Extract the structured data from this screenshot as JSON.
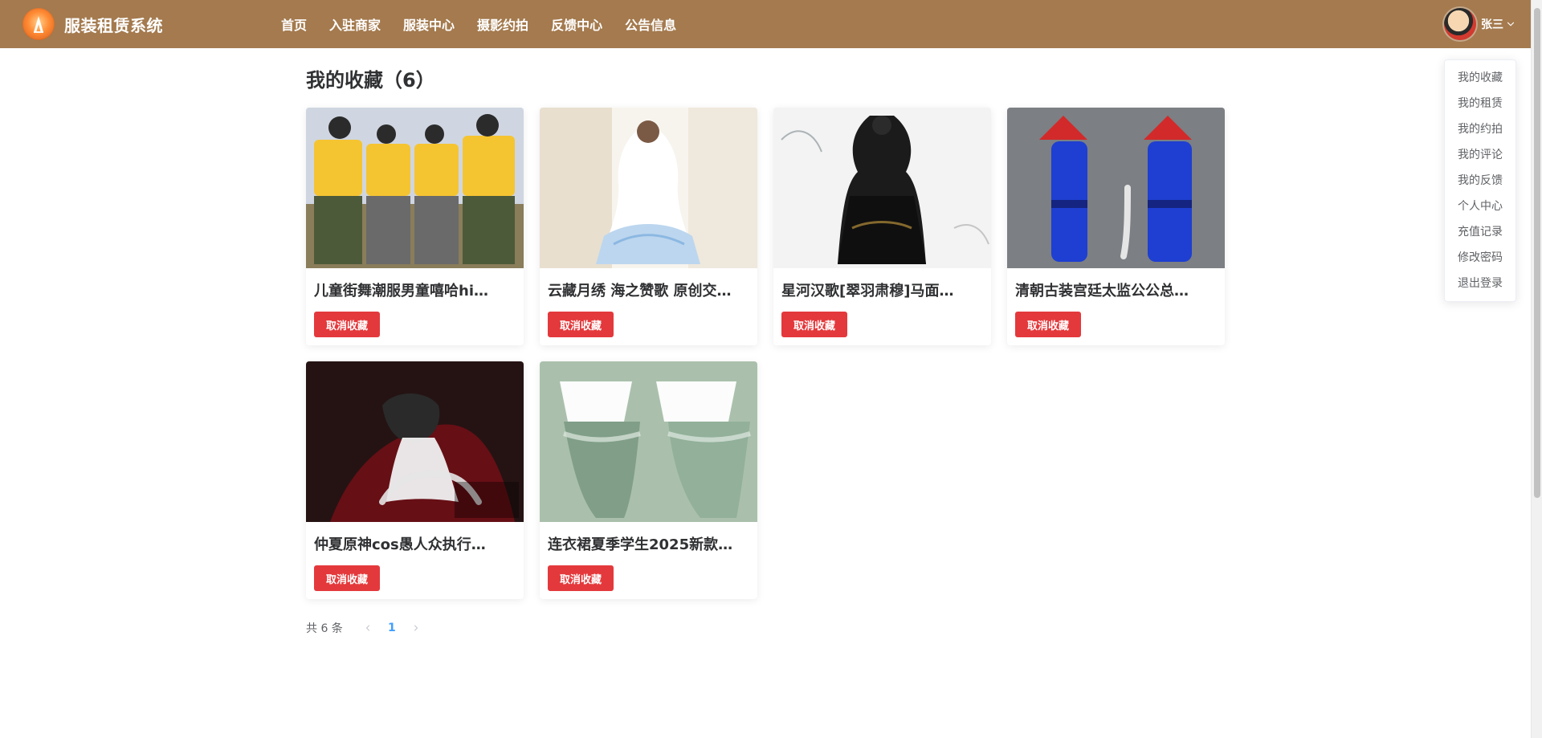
{
  "app": {
    "brand_title": "服装租赁系统"
  },
  "nav": {
    "items": [
      {
        "label": "首页"
      },
      {
        "label": "入驻商家"
      },
      {
        "label": "服装中心"
      },
      {
        "label": "摄影约拍"
      },
      {
        "label": "反馈中心"
      },
      {
        "label": "公告信息"
      }
    ]
  },
  "user": {
    "name": "张三"
  },
  "user_menu": {
    "items": [
      {
        "label": "我的收藏"
      },
      {
        "label": "我的租赁"
      },
      {
        "label": "我的约拍"
      },
      {
        "label": "我的评论"
      },
      {
        "label": "我的反馈"
      },
      {
        "label": "个人中心"
      },
      {
        "label": "充值记录"
      },
      {
        "label": "修改密码"
      },
      {
        "label": "退出登录"
      }
    ]
  },
  "main": {
    "title": "我的收藏（6）",
    "cards": [
      {
        "title": "儿童街舞潮服男童嘻哈hi…",
        "button_label": "取消收藏"
      },
      {
        "title": "云藏月绣 海之赞歌 原创交…",
        "button_label": "取消收藏"
      },
      {
        "title": "星河汉歌[翠羽肃穆]马面…",
        "button_label": "取消收藏"
      },
      {
        "title": "清朝古装宫廷太监公公总…",
        "button_label": "取消收藏"
      },
      {
        "title": "仲夏原神cos愚人众执行…",
        "button_label": "取消收藏"
      },
      {
        "title": "连衣裙夏季学生2025新款…",
        "button_label": "取消收藏"
      }
    ]
  },
  "pagination": {
    "total_label": "共 6 条",
    "current_page": "1"
  },
  "colors": {
    "header_bg": "#a47a4e",
    "danger": "#e4393c",
    "link": "#409eff"
  },
  "icons": {
    "logo": "brand-logo-icon",
    "avatar": "user-avatar",
    "dropdown": "chevron-down-icon",
    "prev": "chevron-left-icon",
    "next": "chevron-right-icon"
  }
}
